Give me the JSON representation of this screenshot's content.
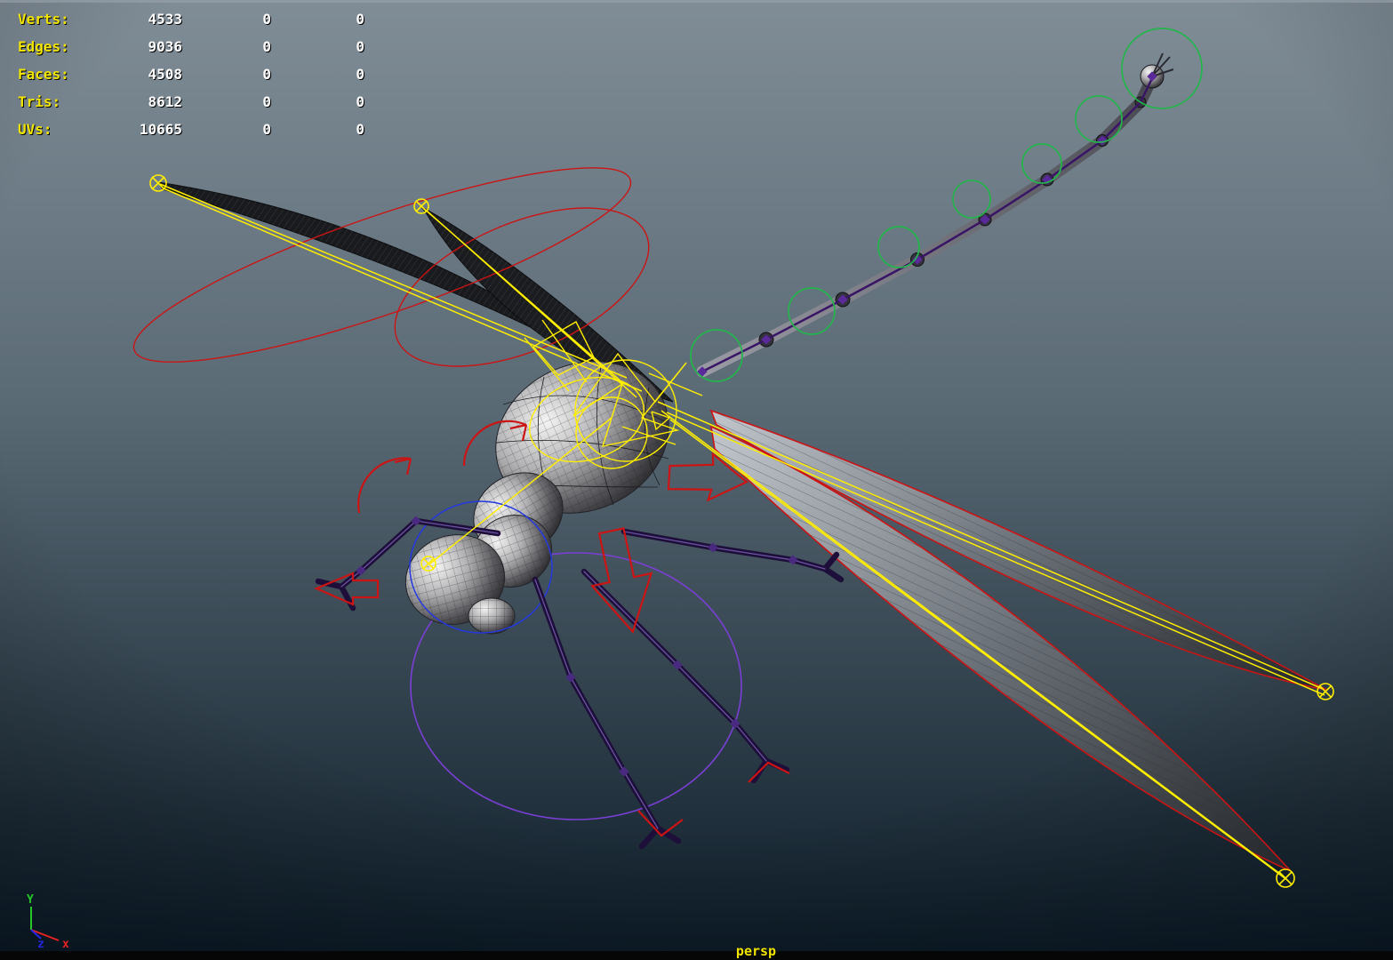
{
  "viewport": {
    "hud": {
      "rows": [
        {
          "label": "Verts:",
          "total": "4533",
          "col2": "0",
          "col3": "0"
        },
        {
          "label": "Edges:",
          "total": "9036",
          "col2": "0",
          "col3": "0"
        },
        {
          "label": "Faces:",
          "total": "4508",
          "col2": "0",
          "col3": "0"
        },
        {
          "label": "Tris:",
          "total": "8612",
          "col2": "0",
          "col3": "0"
        },
        {
          "label": "UVs:",
          "total": "10665",
          "col2": "0",
          "col3": "0"
        }
      ]
    },
    "camera_label": "persp",
    "axis_gizmo": {
      "y": "Y",
      "x": "x",
      "z": "z"
    },
    "colors": {
      "bg_top": "#808d97",
      "bg_mid": "#5a6a75",
      "bg_bottom": "#0c1c28",
      "hud_label": "#f0e400",
      "hud_value": "#ffffff",
      "camera_label": "#f0e400",
      "control_yellow": "#ffee00",
      "control_red": "#cc1414",
      "control_green": "#23b54b",
      "control_purple": "#7a3fd4",
      "control_blue": "#2438e0",
      "axis_x": "#e82222",
      "axis_y": "#25c825",
      "axis_z": "#2525e8"
    }
  },
  "scene": {
    "model_name": "rigged dragonfly wireframe model"
  }
}
